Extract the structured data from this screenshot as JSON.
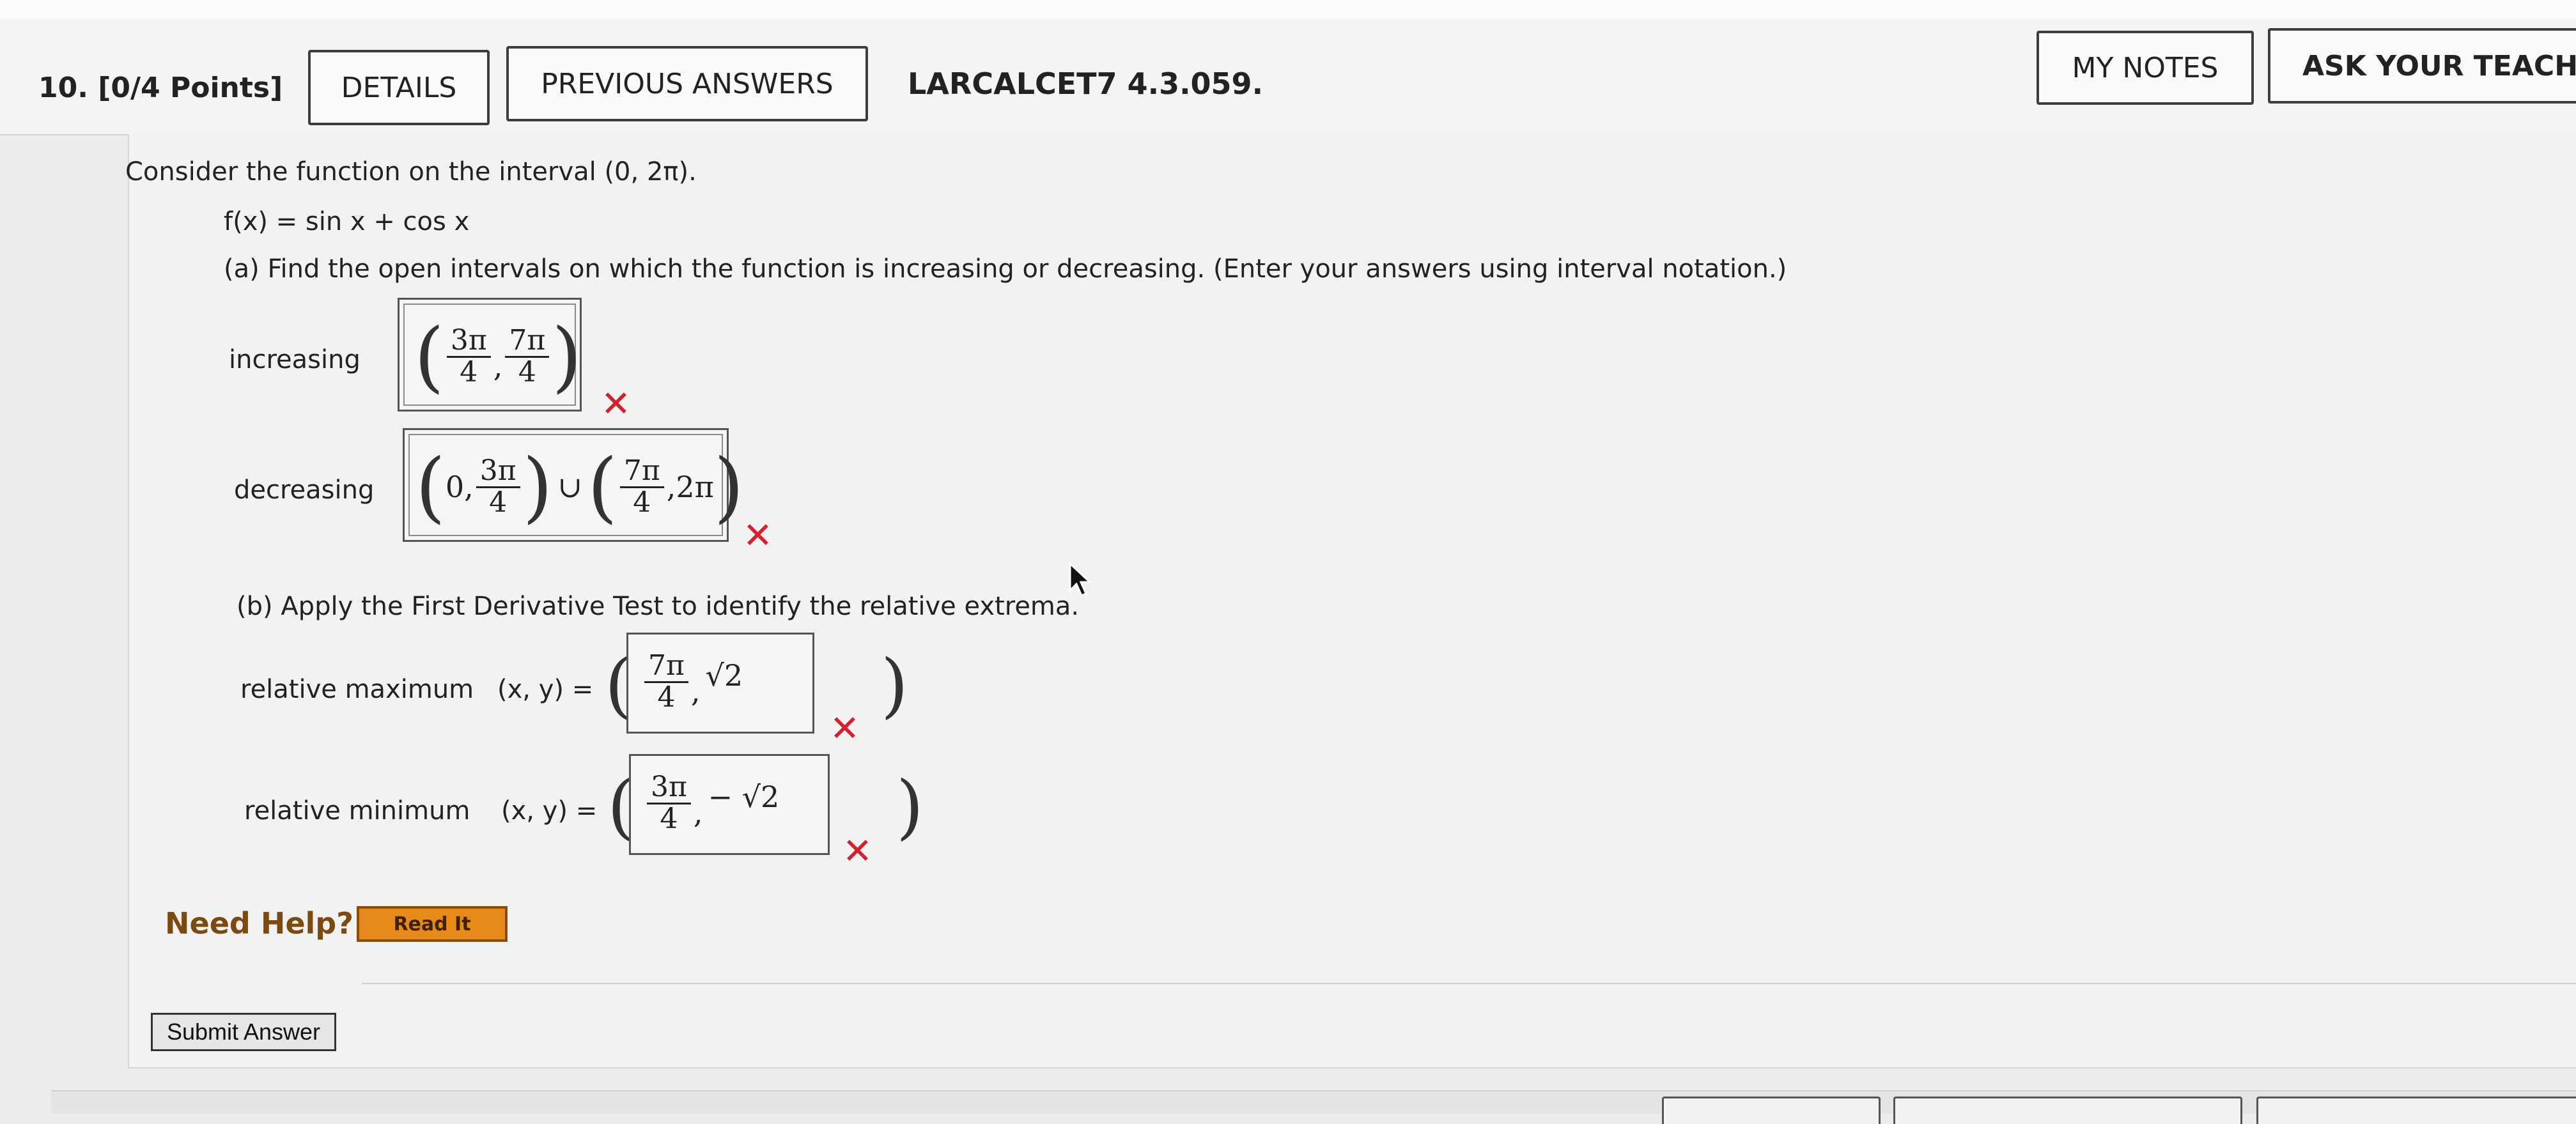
{
  "header": {
    "question_label": "10. [0/4 Points]",
    "details_label": "DETAILS",
    "previous_answers_label": "PREVIOUS ANSWERS",
    "problem_code": "LARCALCET7 4.3.059.",
    "my_notes_label": "MY NOTES",
    "ask_teacher_label": "ASK YOUR TEACHER"
  },
  "problem": {
    "intro": "Consider the function on the interval (0, 2π).",
    "function": "f(x) = sin x + cos x",
    "part_a": "(a) Find the open intervals on which the function is increasing or decreasing. (Enter your answers using interval notation.)",
    "increasing_label": "increasing",
    "decreasing_label": "decreasing",
    "part_b": "(b) Apply the First Derivative Test to identify the relative extrema.",
    "rel_max_label": "relative maximum",
    "rel_min_label": "relative minimum",
    "xy_label": "(x, y) ="
  },
  "answers": {
    "increasing": {
      "open": "(",
      "a_num": "3π",
      "a_den": "4",
      "sep": ",",
      "b_num": "7π",
      "b_den": "4",
      "close": ")"
    },
    "decreasing": {
      "p1_open": "(",
      "p1_start": "0,",
      "p1_num": "3π",
      "p1_den": "4",
      "p1_close": ")",
      "union": "∪",
      "p2_open": "(",
      "p2_num": "7π",
      "p2_den": "4",
      "p2_end": ",2π",
      "p2_close": ")"
    },
    "rel_max": {
      "num": "7π",
      "den": "4",
      "sep": ",",
      "y": "√2"
    },
    "rel_min": {
      "num": "3π",
      "den": "4",
      "sep": ",",
      "y": "− √2"
    },
    "incorrect_mark": "✕"
  },
  "help": {
    "need_help_label": "Need Help?",
    "read_it_label": "Read It"
  },
  "footer": {
    "submit_label": "Submit Answer"
  },
  "colors": {
    "incorrect": "#d0212d",
    "read_it_bg": "#e88a1a",
    "need_help_text": "#7a4a10"
  }
}
